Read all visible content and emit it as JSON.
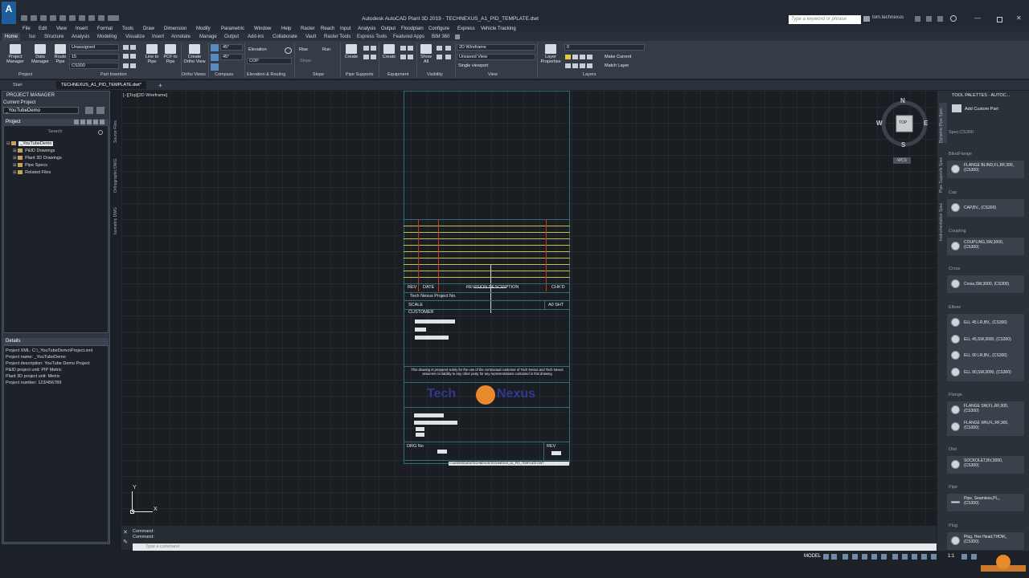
{
  "window": {
    "title": "Autodesk AutoCAD Plant 3D 2019 - TECHNEXUS_A1_PID_TEMPLATE.dwt",
    "search_placeholder": "Type a keyword or phrase",
    "user": "tom.technexus",
    "logo": "A"
  },
  "menubar": [
    "File",
    "Edit",
    "View",
    "Insert",
    "Format",
    "Tools",
    "Draw",
    "Dimension",
    "Modify",
    "Parametric",
    "Window",
    "Help",
    "Raster",
    "Reach",
    "Input",
    "Analysis",
    "Output",
    "Floodplain",
    "Configure",
    "Express",
    "Vehicle Tracking"
  ],
  "ribbon_tabs": [
    "Home",
    "Iso",
    "Structure",
    "Analysis",
    "Modeling",
    "Visualize",
    "Insert",
    "Annotate",
    "Manage",
    "Output",
    "Add-ins",
    "Collaborate",
    "Vault",
    "Raster Tools",
    "Express Tools",
    "Featured Apps",
    "BIM 360"
  ],
  "ribbon": {
    "project_manager": "Project\nManager",
    "data_manager": "Data\nManager",
    "route_pipe": "Route\nPipe",
    "spec_dropdown": "Unassigned",
    "size_dropdown": "15",
    "spec2_dropdown": "CS300",
    "line_to_pipe": "Line to\nPipe",
    "pcf_to_pipe": "PCF to\nPipe",
    "create_ortho": "Create\nOrtho View",
    "angle1": "45°",
    "angle2": "45°",
    "elevation_label": "Elevation",
    "cop_label": "COP",
    "rise_label": "Rise",
    "run_label": "Run",
    "slope_label": "Slope",
    "create1": "Create",
    "create2": "Create",
    "show_all": "Show\nAll",
    "visual_style": "2D Wireframe",
    "saved_view": "Unsaved View",
    "viewport": "Single viewport",
    "layer_props": "Layer\nProperties",
    "layer_name": "0",
    "make_current": "Make Current",
    "match_layer": "Match Layer",
    "panels": [
      "Project",
      "Part Insertion",
      "Ortho Views",
      "Compass",
      "Elevation & Routing",
      "Slope",
      "Pipe Supports",
      "Equipment",
      "Visibility",
      "View",
      "Layers"
    ]
  },
  "doc_tabs": [
    "Start",
    "TECHNEXUS_A1_PID_TEMPLATE.dwt*"
  ],
  "left_palette": {
    "title": "PROJECT MANAGER",
    "current_project_label": "Current Project",
    "current_project": "_YouTubeDemo",
    "project_header": "Project",
    "search": "Search",
    "tree": [
      "_YouTubeDemo",
      "P&ID Drawings",
      "Plant 3D Drawings",
      "Pipe Specs",
      "Related Files"
    ],
    "details_header": "Details",
    "details": [
      "Project XML: C:\\_YouTubeDemo\\Project.xml",
      "Project name: _YouTubeDemo",
      "Project description: YouTube Demo Project",
      "P&ID project unit: PIP Metric",
      "Plant 3D project unit: Metric",
      "Project number: 123/456789"
    ],
    "side_tabs": [
      "Source Files",
      "Orthographic DWG",
      "Isometric DWG"
    ]
  },
  "viewport_label": "[−][Top][2D Wireframe]",
  "title_block": {
    "rev": "REV",
    "date": "DATE",
    "revision_description": "REVISION DESCRIPTION",
    "chkd": "CHK'D",
    "project_no": "Tech Nexus Project No.",
    "scale": "SCALE",
    "sheet": "A0 SHT",
    "customer": "CUSTOMER",
    "disclaimer": "This drawing is prepared solely for the use of the contractual customer of Tech Nexus and Tech Nexus assumes no liability to any other party for any representations contained in this drawing",
    "logo_left": "Tech",
    "logo_right": "Nexus",
    "drg_no": "DRG No",
    "rev2": "REV",
    "path": "C:\\USERS\\DATA\\TECHNEXUS\\TECHNEXUS_A1_PID_TEMPLATE.DWT"
  },
  "compass": {
    "n": "N",
    "s": "S",
    "e": "E",
    "w": "W",
    "top": "TOP",
    "wcs": "WCS"
  },
  "ucs": {
    "x": "X",
    "y": "Y"
  },
  "command": {
    "history": [
      "Command:",
      "Command:"
    ],
    "placeholder": "Type a command"
  },
  "tool_palette": {
    "title": "TOOL PALETTES - AUTOC...",
    "side_tabs": [
      "Dynamic Pipe Spec",
      "Pipe Supports Spec",
      "Instrumentation Spec"
    ],
    "add_custom_part": "Add Custom Part",
    "spec": "Spec:CS300",
    "sections": [
      {
        "name": "BlindFlange",
        "items": [
          "FLANGE BLIND,FL,RF,300,\n(CS300)"
        ]
      },
      {
        "name": "Cap",
        "items": [
          "CAP,BV,, (CS300)"
        ]
      },
      {
        "name": "Coupling",
        "items": [
          "COUPLING,SW,3000,\n(CS300)"
        ]
      },
      {
        "name": "Cross",
        "items": [
          "Cross,SW,3000, (CS300)"
        ]
      },
      {
        "name": "Elbow",
        "items": [
          "ELL 45 LR,BV,, (CS300)",
          "ELL 45,SW,3000, (CS300)",
          "ELL 90 LR,BV,, (CS300)",
          "ELL 90,SW,3000, (CS300)"
        ]
      },
      {
        "name": "Flange",
        "items": [
          "FLANGE SW,FL,RF,300,\n(CS300)",
          "FLANGE WN,FL,RF,300,\n(CS300)"
        ]
      },
      {
        "name": "Olet",
        "items": [
          "SOCKOLET,BV,3000,\n(CS300)"
        ]
      },
      {
        "name": "Pipe",
        "items": [
          "Pipe, Seamless,PL,,\n(CS300)"
        ]
      },
      {
        "name": "Plug",
        "items": [
          "Plug, Hex Head,THDM,,\n(CS300)"
        ]
      }
    ]
  },
  "status": {
    "model": "MODEL",
    "scale": "1:1"
  }
}
